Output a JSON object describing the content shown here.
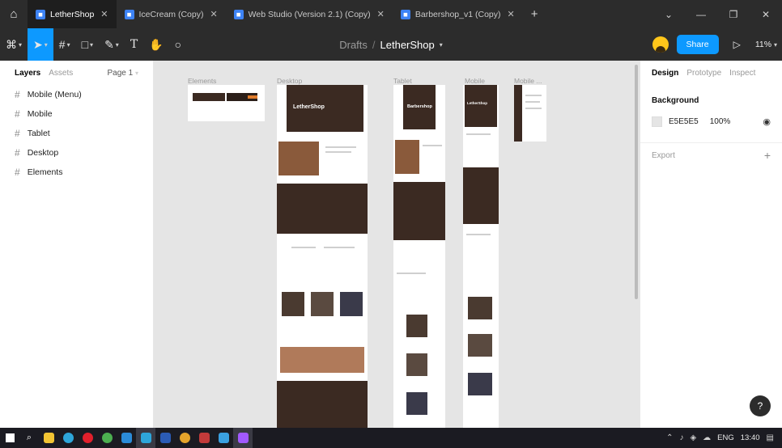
{
  "tabs": [
    {
      "label": "LetherShop",
      "active": true
    },
    {
      "label": "IceCream (Copy)",
      "active": false
    },
    {
      "label": "Web Studio (Version 2.1) (Copy)",
      "active": false
    },
    {
      "label": "Barbershop_v1 (Copy)",
      "active": false
    }
  ],
  "tab_close_glyph": "✕",
  "tab_add_glyph": "+",
  "breadcrumb": {
    "project": "Drafts",
    "separator": "/",
    "file": "LetherShop"
  },
  "toolbar": {
    "share_label": "Share",
    "zoom": "11%"
  },
  "left_panel": {
    "tabs": [
      "Layers",
      "Assets"
    ],
    "page": "Page 1",
    "layers": [
      "Mobile (Menu)",
      "Mobile",
      "Tablet",
      "Desktop",
      "Elements"
    ]
  },
  "canvas": {
    "frame_labels": [
      "Elements",
      "Desktop",
      "Tablet",
      "Mobile",
      "Mobile ..."
    ],
    "desktop_hero_title": "LetherShop",
    "tablet_hero_title": "Barbershop",
    "mobile_hero_title": "LetherShop"
  },
  "right_panel": {
    "tabs": [
      "Design",
      "Prototype",
      "Inspect"
    ],
    "background_title": "Background",
    "background_hex": "E5E5E5",
    "background_opacity": "100%",
    "export_label": "Export"
  },
  "help_label": "?",
  "taskbar": {
    "language": "ENG",
    "time": "13:40"
  },
  "colors": {
    "accent": "#0d99ff",
    "chrome": "#2c2c2c",
    "canvas": "#e5e5e5"
  }
}
